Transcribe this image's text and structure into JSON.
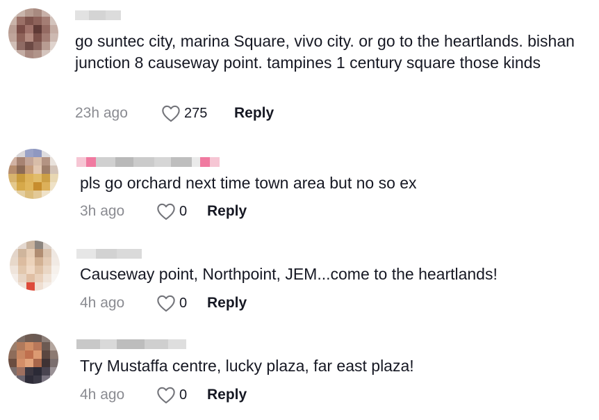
{
  "comments": [
    {
      "text": "go suntec city, marina Square, vivo city. or go to the heartlands. bishan junction 8 causeway point. tampines 1 century square those kinds",
      "time": "23h ago",
      "likes": "275",
      "reply": "Reply"
    },
    {
      "text": "pls go orchard next time town area but no so ex",
      "time": "3h ago",
      "likes": "0",
      "reply": "Reply"
    },
    {
      "text": "Causeway point, Northpoint, JEM...come to the heartlands!",
      "time": "4h ago",
      "likes": "0",
      "reply": "Reply"
    },
    {
      "text": "Try Mustaffa centre, lucky plaza, far east plaza!",
      "time": "4h ago",
      "likes": "0",
      "reply": "Reply"
    }
  ],
  "icons": {
    "like": "heart-outline-icon"
  },
  "colors": {
    "muted": "#8a8b91",
    "text": "#161823"
  }
}
